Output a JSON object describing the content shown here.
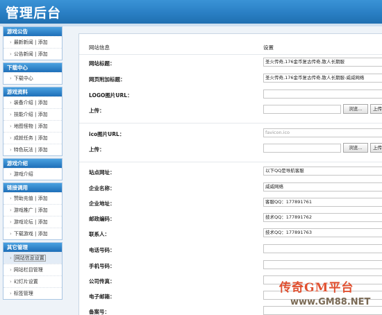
{
  "header": {
    "title": "管理后台"
  },
  "sidebar": [
    {
      "title": "游戏公告",
      "items": [
        {
          "label": "最新新闻",
          "add": "添加"
        },
        {
          "label": "公告新闻",
          "add": "添加"
        }
      ]
    },
    {
      "title": "下载中心",
      "items": [
        {
          "label": "下载中心",
          "add": ""
        }
      ]
    },
    {
      "title": "游戏资料",
      "items": [
        {
          "label": "装备介绍",
          "add": "添加"
        },
        {
          "label": "技能介绍",
          "add": "添加"
        },
        {
          "label": "地图怪物",
          "add": "添加"
        },
        {
          "label": "成就任务",
          "add": "添加"
        },
        {
          "label": "特色玩法",
          "add": "添加"
        }
      ]
    },
    {
      "title": "游戏介绍",
      "items": [
        {
          "label": "游戏介绍",
          "add": ""
        }
      ]
    },
    {
      "title": "链接调用",
      "items": [
        {
          "label": "赞助充值",
          "add": "添加"
        },
        {
          "label": "游戏推广",
          "add": "添加"
        },
        {
          "label": "游戏论坛",
          "add": "添加"
        },
        {
          "label": "下载游戏",
          "add": "添加"
        }
      ]
    },
    {
      "title": "其它管理",
      "items": [
        {
          "label": "网站信息设置",
          "add": "",
          "selected": true
        },
        {
          "label": "网站栏目管理",
          "add": ""
        },
        {
          "label": "幻灯片设置",
          "add": ""
        },
        {
          "label": "标签管理",
          "add": ""
        }
      ]
    }
  ],
  "form": {
    "col_info": "网站信息",
    "col_setting": "设置",
    "site_title": {
      "label": "网站标题：",
      "value": "圣火传奇,176金币复古传奇,散人长期服"
    },
    "site_sub_title": {
      "label": "网页附加标题：",
      "value": "圣火传奇,176金币复古传奇,散人长期服-威威网络"
    },
    "logo_url": {
      "label": "LOGO图片URL：",
      "value": ""
    },
    "logo_upload": {
      "label": "上传：",
      "browse": "浏览...",
      "upload": "上传"
    },
    "ico_url": {
      "label": "ico图片URL：",
      "value": "favicon.ico"
    },
    "ico_upload": {
      "label": "上传：",
      "browse": "浏览...",
      "upload": "上传"
    },
    "site_url": {
      "label": "站点网址：",
      "value": "以下QQ是导航客服"
    },
    "company": {
      "label": "企业名称：",
      "value": "威威网络"
    },
    "address": {
      "label": "企业地址：",
      "value": "客服QQ：177891761"
    },
    "postcode": {
      "label": "邮政编码：",
      "value": "技术QQ：177891762"
    },
    "contact": {
      "label": "联系人：",
      "value": "技术QQ：177891763"
    },
    "phone": {
      "label": "电话号码：",
      "value": ""
    },
    "mobile": {
      "label": "手机号码：",
      "value": ""
    },
    "fax": {
      "label": "公司传真：",
      "value": ""
    },
    "email": {
      "label": "电子邮箱：",
      "value": ""
    },
    "icp": {
      "label": "备案号：",
      "value": ""
    }
  },
  "watermark": {
    "line1": "传奇GM平台",
    "line2": "www.GM88.NET"
  }
}
